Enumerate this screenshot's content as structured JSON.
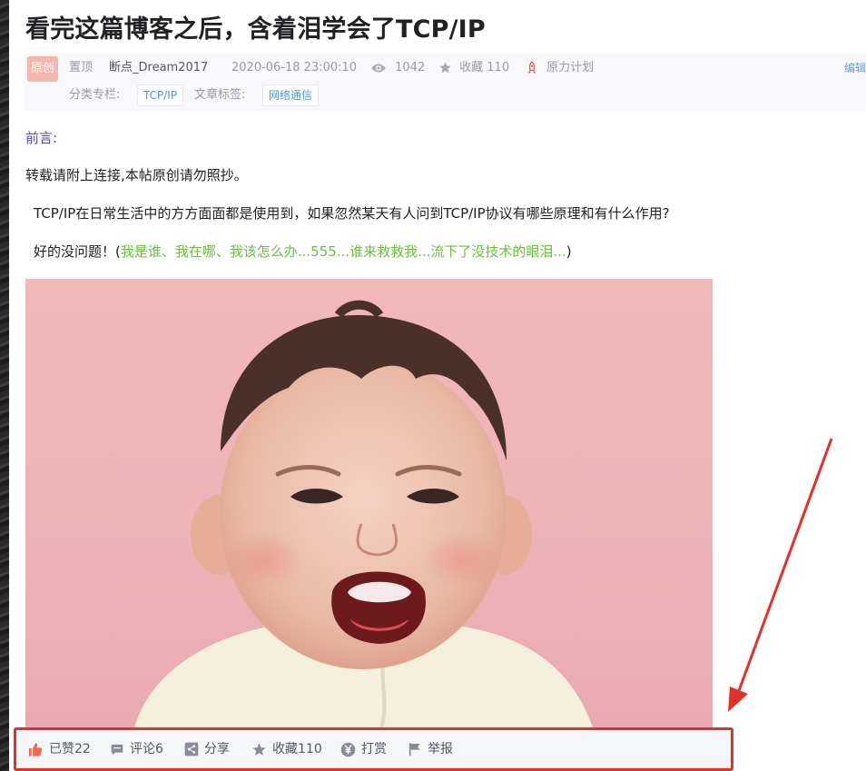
{
  "article": {
    "title": "看完这篇博客之后，含着泪学会了TCP/IP",
    "meta": {
      "badge": "原创",
      "pinned": "置顶",
      "author": "断点_Dream2017",
      "datetime": "2020-06-18 23:00:10",
      "views": "1042",
      "favorites_label": "收藏 110",
      "plan": "原力计划",
      "edit": "编辑",
      "category_label": "分类专栏:",
      "category_tag": "TCP/IP",
      "article_tag_label": "文章标签:",
      "article_tag": "网络通信"
    },
    "body": {
      "preface": "前言:",
      "repost_note": "转载请附上连接,本帖原创请勿照抄。",
      "intro": "TCP/IP在日常生活中的方方面面都是使用到，如果忽然某天有人问到TCP/IP协议有哪些原理和有什么作用?",
      "reply_prefix": "好的没问题！(",
      "reply_green": "我是谁、我在哪、我该怎么办...555...谁来救救我...流下了没技术的眼泪...",
      "reply_suffix": ")"
    }
  },
  "action_bar": {
    "like": "已赞22",
    "comment": "评论6",
    "share": "分享",
    "favorite": "收藏110",
    "reward": "打赏",
    "report": "举报"
  },
  "colors": {
    "annotation_red": "#e5302a",
    "preface_purple": "#4d4dc7",
    "green_text": "#67c23a",
    "like_orange": "#f06a4a"
  },
  "icons": [
    "eye-icon",
    "star-icon",
    "rocket-icon",
    "thumbs-up-icon",
    "comment-icon",
    "share-icon",
    "favorite-icon",
    "yen-icon",
    "flag-icon"
  ]
}
